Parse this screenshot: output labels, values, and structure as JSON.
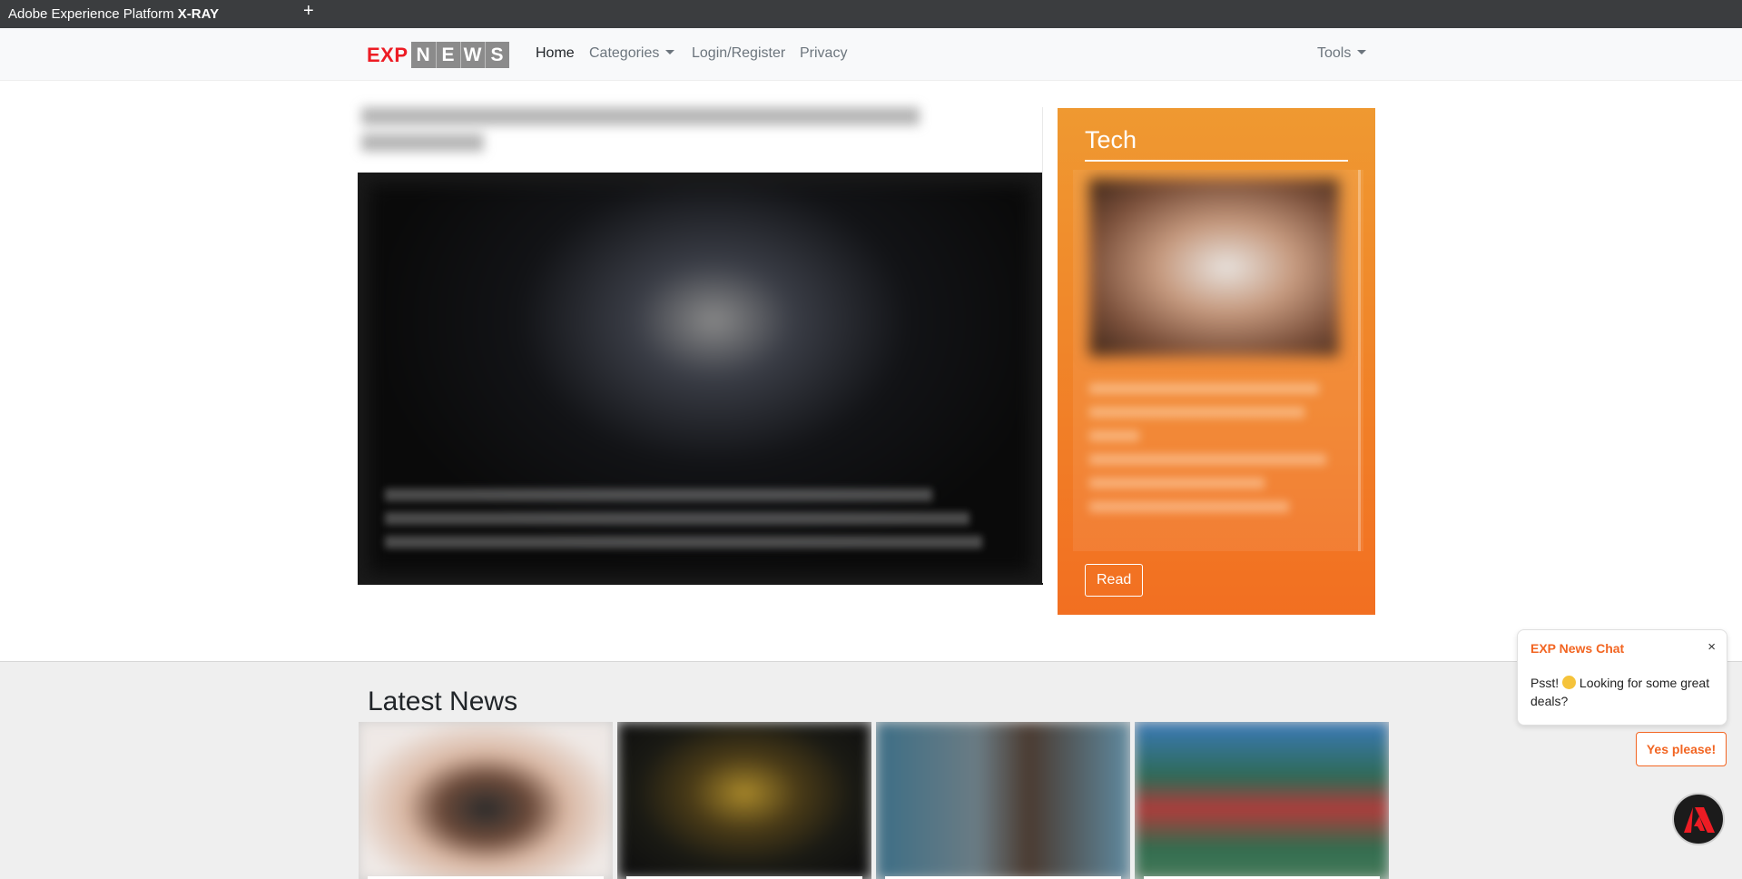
{
  "xray": {
    "title_prefix": "Adobe Experience Platform ",
    "title_bold": "X-RAY",
    "plus": "+"
  },
  "nav": {
    "logo_exp": "EXP",
    "logo_news": [
      "N",
      "E",
      "W",
      "S"
    ],
    "items": [
      {
        "label": "Home",
        "active": true
      },
      {
        "label": "Categories",
        "dropdown": true
      },
      {
        "label": "Login/Register"
      },
      {
        "label": "Privacy"
      }
    ],
    "tools": "Tools"
  },
  "tech": {
    "title": "Tech",
    "read_label": "Read"
  },
  "latest": {
    "title": "Latest News"
  },
  "chat": {
    "header": "EXP News Chat",
    "close": "×",
    "message": "Psst! 🤫 Looking for some great deals?",
    "message_before": "Psst! ",
    "message_after": " Looking for some great deals?",
    "yes_label": "Yes please!"
  },
  "colors": {
    "accent": "#f26522",
    "tech_top": "#ef9931",
    "tech_bottom": "#f26f21",
    "logo_red": "#ed1c24"
  }
}
